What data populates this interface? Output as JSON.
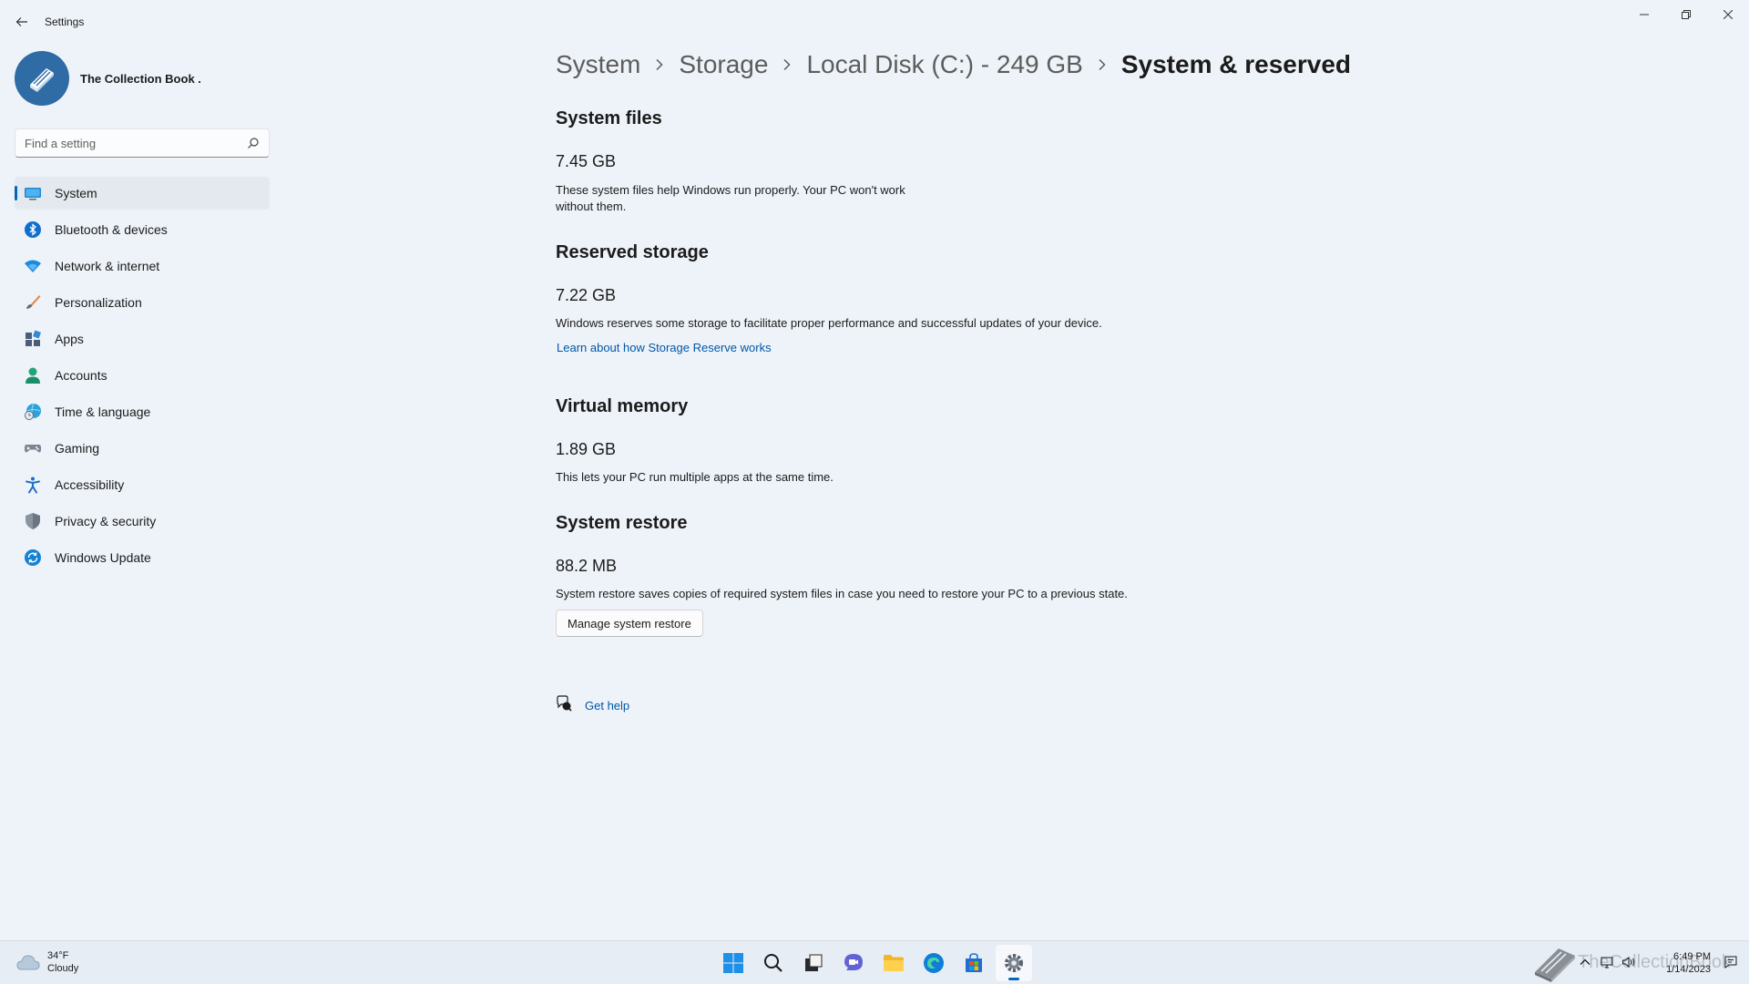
{
  "window": {
    "app_title": "Settings"
  },
  "profile": {
    "name": "The Collection Book ."
  },
  "search": {
    "placeholder": "Find a setting"
  },
  "sidebar": {
    "items": [
      {
        "label": "System",
        "icon": "monitor-icon"
      },
      {
        "label": "Bluetooth & devices",
        "icon": "bluetooth-icon"
      },
      {
        "label": "Network & internet",
        "icon": "wifi-icon"
      },
      {
        "label": "Personalization",
        "icon": "brush-icon"
      },
      {
        "label": "Apps",
        "icon": "apps-icon"
      },
      {
        "label": "Accounts",
        "icon": "person-icon"
      },
      {
        "label": "Time & language",
        "icon": "globe-clock-icon"
      },
      {
        "label": "Gaming",
        "icon": "gamepad-icon"
      },
      {
        "label": "Accessibility",
        "icon": "accessibility-icon"
      },
      {
        "label": "Privacy & security",
        "icon": "shield-icon"
      },
      {
        "label": "Windows Update",
        "icon": "update-icon"
      }
    ]
  },
  "breadcrumb": {
    "items": [
      "System",
      "Storage",
      "Local Disk (C:) - 249 GB",
      "System & reserved"
    ]
  },
  "sections": {
    "system_files": {
      "title": "System files",
      "size": "7.45 GB",
      "desc_line1": "These system files help Windows run properly. Your PC won't work",
      "desc_line2": "without them."
    },
    "reserved_storage": {
      "title": "Reserved storage",
      "size": "7.22 GB",
      "desc": "Windows reserves some storage to facilitate proper performance and successful updates of your device.",
      "link": "Learn about how Storage Reserve works"
    },
    "virtual_memory": {
      "title": "Virtual memory",
      "size": "1.89 GB",
      "desc": "This lets your PC run multiple apps at the same time."
    },
    "system_restore": {
      "title": "System restore",
      "size": "88.2 MB",
      "desc": "System restore saves copies of required system files in case you need to restore your PC to a previous state.",
      "button": "Manage system restore"
    }
  },
  "help": {
    "label": "Get help"
  },
  "taskbar": {
    "weather_temp": "34°F",
    "weather_cond": "Cloudy",
    "time": "6:49 PM",
    "date": "1/14/2023",
    "watermark": "TheCollectionBook"
  },
  "colors": {
    "accent": "#0067c0",
    "link": "#0057a8",
    "background": "#eef3f9"
  }
}
